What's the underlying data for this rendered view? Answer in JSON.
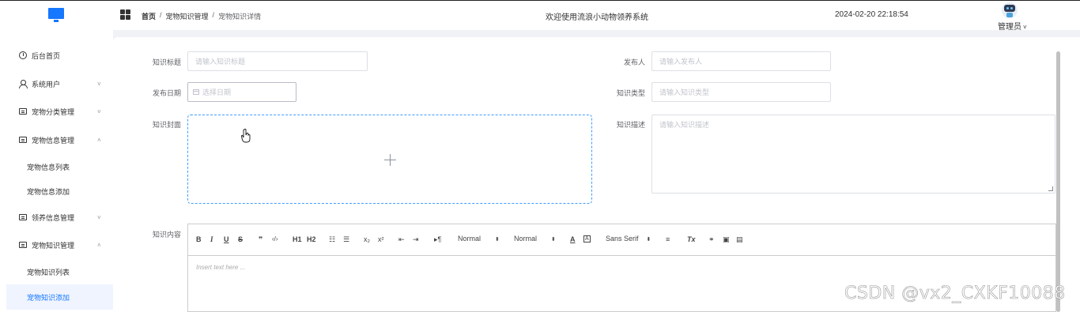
{
  "header": {
    "breadcrumb": [
      "首页",
      "宠物知识管理",
      "宠物知识详情"
    ],
    "welcome": "欢迎使用流浪小动物领养系统",
    "datetime": "2024-02-20 22:18:54",
    "user": "管理员",
    "user_caret": "˅"
  },
  "sidebar": {
    "items": [
      {
        "label": "后台首页",
        "icon": "clock-icon"
      },
      {
        "label": "系统用户",
        "icon": "user-icon",
        "arrow": "˅"
      },
      {
        "label": "宠物分类管理",
        "icon": "card-icon",
        "arrow": "˅"
      },
      {
        "label": "宠物信息管理",
        "icon": "card-icon",
        "arrow": "˄"
      },
      {
        "label": "宠物信息列表"
      },
      {
        "label": "宠物信息添加"
      },
      {
        "label": "领养信息管理",
        "icon": "card-icon",
        "arrow": "˅"
      },
      {
        "label": "宠物知识管理",
        "icon": "card-icon",
        "arrow": "˄"
      },
      {
        "label": "宠物知识列表"
      },
      {
        "label": "宠物知识添加",
        "active": true
      }
    ]
  },
  "form": {
    "title_label": "知识标题",
    "title_placeholder": "请输入知识标题",
    "publisher_label": "发布人",
    "publisher_placeholder": "请输入发布人",
    "date_label": "发布日期",
    "date_placeholder": "选择日期",
    "type_label": "知识类型",
    "type_placeholder": "请输入知识类型",
    "cover_label": "知识封面",
    "desc_label": "知识描述",
    "desc_placeholder": "请输入知识描述",
    "content_label": "知识内容"
  },
  "editor": {
    "header_1": "H1",
    "header_2": "H2",
    "sub": "x₂",
    "sup": "x²",
    "quote": "❞",
    "code": "‹/›",
    "rtl": "▸¶",
    "size_value": "Normal",
    "header_value": "Normal",
    "font_value": "Sans Serif",
    "placeholder": "Insert text here ..."
  },
  "watermark": "CSDN @vx2_CXKF10088",
  "colors": {
    "accent": "#1677ff",
    "upload_border": "#409eff"
  }
}
